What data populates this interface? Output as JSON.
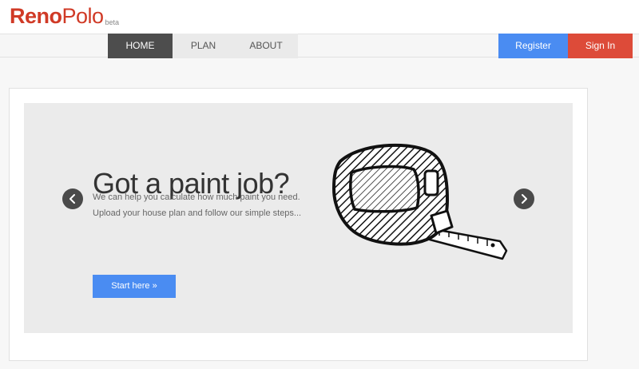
{
  "brand": {
    "name_part1": "Reno",
    "name_part2": "Polo",
    "badge": "beta",
    "color": "#d03a26"
  },
  "nav": {
    "tabs": [
      {
        "label": "HOME",
        "active": true
      },
      {
        "label": "PLAN",
        "active": false
      },
      {
        "label": "ABOUT",
        "active": false
      }
    ],
    "register_label": "Register",
    "signin_label": "Sign In"
  },
  "hero": {
    "headline": "Got a paint job?",
    "description_line1": "We can help you calculate how much paint you need.",
    "description_line2": "Upload your house plan and follow our simple steps...",
    "cta_label": "Start here »",
    "illustration": "tape-measure-icon",
    "prev_icon": "chevron-left-icon",
    "next_icon": "chevron-right-icon"
  },
  "colors": {
    "accent_blue": "#4a8cf2",
    "accent_red": "#dd4b39",
    "active_tab": "#4d4d4d"
  }
}
